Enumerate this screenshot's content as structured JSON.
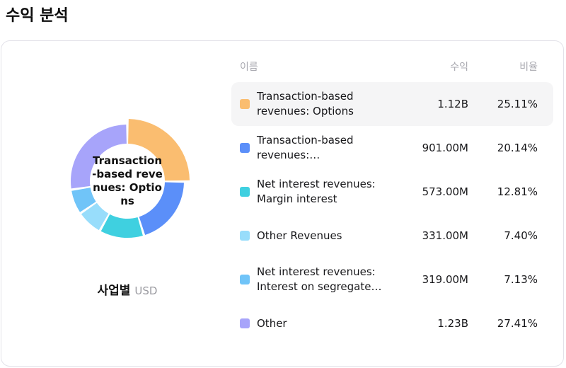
{
  "page": {
    "title": "수익 분석"
  },
  "card": {
    "footer": {
      "label": "사업별",
      "unit": "USD"
    },
    "table": {
      "headers": {
        "name": "이름",
        "value": "수익",
        "ratio": "비율"
      },
      "rows": [
        {
          "name": "Transaction-based revenues: Options",
          "value": "1.12B",
          "ratio": "25.11%",
          "color": "#FABD70",
          "highlighted": true
        },
        {
          "name": "Transaction-based revenues:…",
          "value": "901.00M",
          "ratio": "20.14%",
          "color": "#5B8FF9",
          "highlighted": false
        },
        {
          "name": "Net interest revenues: Margin interest",
          "value": "573.00M",
          "ratio": "12.81%",
          "color": "#3FD0E0",
          "highlighted": false
        },
        {
          "name": "Other Revenues",
          "value": "331.00M",
          "ratio": "7.40%",
          "color": "#98DDFB",
          "highlighted": false
        },
        {
          "name": "Net interest revenues: Interest on segregate…",
          "value": "319.00M",
          "ratio": "7.13%",
          "color": "#70C4F8",
          "highlighted": false
        },
        {
          "name": "Other",
          "value": "1.23B",
          "ratio": "27.41%",
          "color": "#A7A4FA",
          "highlighted": false
        }
      ]
    }
  },
  "chart_data": {
    "type": "pie",
    "subtype": "donut",
    "title": "수익 분석",
    "group_label": "사업별",
    "unit": "USD",
    "legend_position": "right",
    "center_label": "Transaction-based revenues: Options",
    "categories": [
      "Transaction-based revenues: Options",
      "Transaction-based revenues:…",
      "Net interest revenues: Margin interest",
      "Other Revenues",
      "Net interest revenues: Interest on segregate…",
      "Other"
    ],
    "values": [
      "1.12B",
      "901.00M",
      "573.00M",
      "331.00M",
      "319.00M",
      "1.23B"
    ],
    "percentages": [
      25.11,
      20.14,
      12.81,
      7.4,
      7.13,
      27.41
    ],
    "colors": [
      "#FABD70",
      "#5B8FF9",
      "#3FD0E0",
      "#98DDFB",
      "#70C4F8",
      "#A7A4FA"
    ],
    "highlighted_index": 0
  }
}
